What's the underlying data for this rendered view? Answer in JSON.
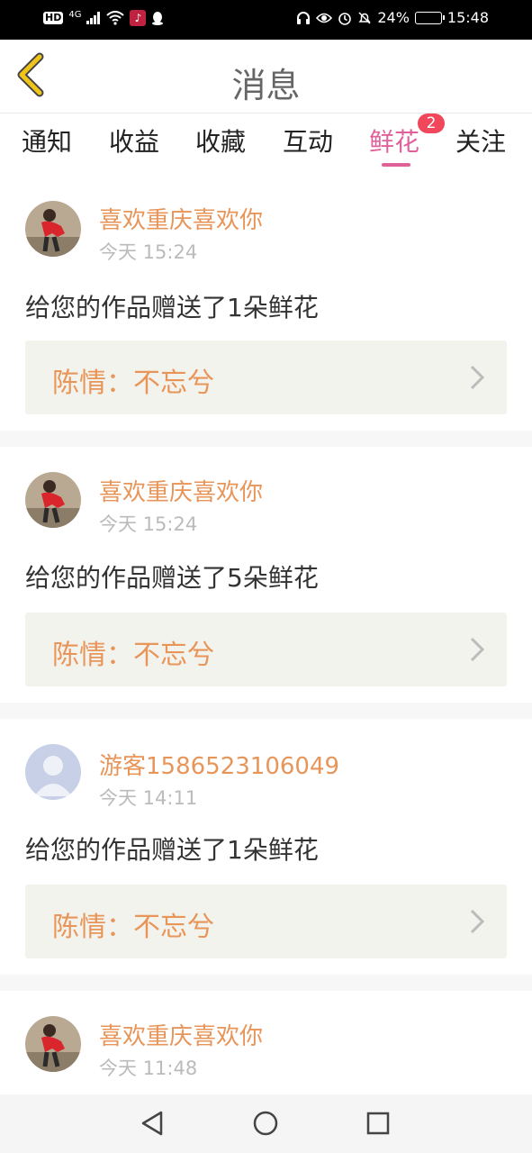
{
  "status_bar": {
    "time": "15:48",
    "battery": "24%",
    "network": "4G",
    "hd": "HD"
  },
  "header": {
    "title": "消息",
    "back_icon": "chevron-left-icon"
  },
  "tabs": [
    {
      "label": "通知"
    },
    {
      "label": "收益"
    },
    {
      "label": "收藏"
    },
    {
      "label": "互动"
    },
    {
      "label": "鲜花",
      "active": true,
      "badge": "2"
    },
    {
      "label": "关注"
    }
  ],
  "messages": [
    {
      "user": "喜欢重庆喜欢你",
      "time": "今天 15:24",
      "text": "给您的作品赠送了1朵鲜花",
      "work": "陈情：不忘兮",
      "avatar": "photo"
    },
    {
      "user": "喜欢重庆喜欢你",
      "time": "今天 15:24",
      "text": "给您的作品赠送了5朵鲜花",
      "work": "陈情：不忘兮",
      "avatar": "photo"
    },
    {
      "user": "游客1586523106049",
      "time": "今天 14:11",
      "text": "给您的作品赠送了1朵鲜花",
      "work": "陈情：不忘兮",
      "avatar": "default"
    },
    {
      "user": "喜欢重庆喜欢你",
      "time": "今天 11:48",
      "avatar": "photo"
    }
  ],
  "colors": {
    "accent": "#e0609a",
    "username": "#e8955a",
    "badge": "#f0485a",
    "back_arrow": "#f0c419"
  },
  "navbar": {
    "icons": [
      "back-triangle-icon",
      "home-circle-icon",
      "recents-square-icon"
    ]
  }
}
